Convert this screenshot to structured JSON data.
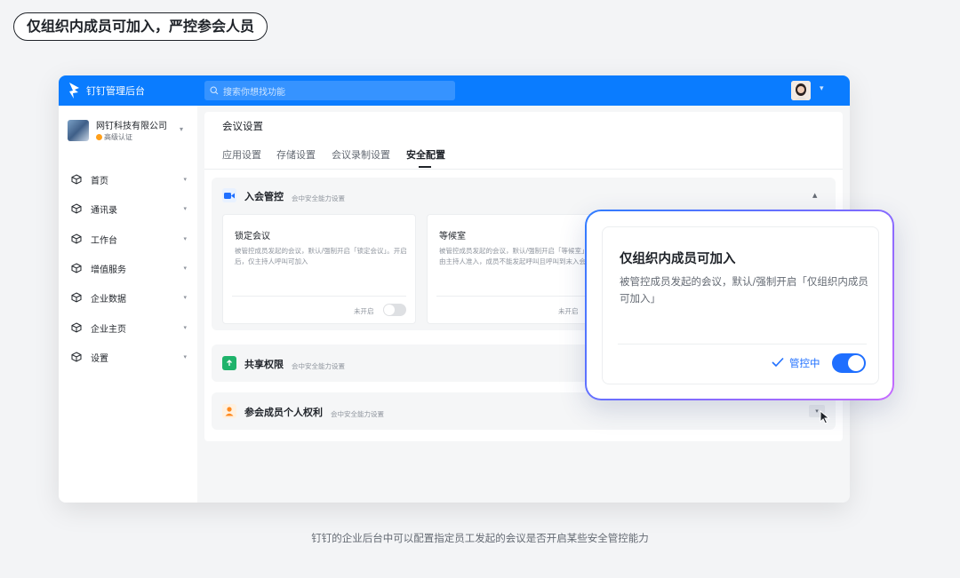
{
  "headline": "仅组织内成员可加入，严控参会人员",
  "app": {
    "name": "钉钉管理后台"
  },
  "search": {
    "placeholder": "搜索你想找功能"
  },
  "org": {
    "name": "网钉科技有限公司",
    "badge": "高级认证"
  },
  "sidebar": {
    "items": [
      {
        "label": "首页",
        "icon": "cube-icon"
      },
      {
        "label": "通讯录",
        "icon": "cube-icon"
      },
      {
        "label": "工作台",
        "icon": "cube-icon"
      },
      {
        "label": "增值服务",
        "icon": "cube-icon"
      },
      {
        "label": "企业数据",
        "icon": "cube-icon"
      },
      {
        "label": "企业主页",
        "icon": "cube-icon"
      },
      {
        "label": "设置",
        "icon": "cube-icon"
      }
    ]
  },
  "page": {
    "title": "会议设置",
    "tabs": [
      "应用设置",
      "存储设置",
      "会议录制设置",
      "安全配置"
    ],
    "active_tab": "安全配置"
  },
  "sections": [
    {
      "title": "入会管控",
      "subtitle": "会中安全能力设置",
      "icon": "video-camera-icon",
      "expanded": true,
      "cards": [
        {
          "title": "锁定会议",
          "desc": "被管控成员发起的会议，默认/强制开启「锁定会议」。开启后，仅主持人呼叫可加入",
          "state": "未开启",
          "on": false
        },
        {
          "title": "等候室",
          "desc": "被管控成员发起的会议，默认/强制开启「等候室」。成员需由主持人准入，成员不能发起呼叫且呼叫到末入会列表",
          "state": "未开启",
          "on": false
        }
      ]
    },
    {
      "title": "共享权限",
      "subtitle": "会中安全能力设置",
      "icon": "share-screen-icon",
      "expanded": false
    },
    {
      "title": "参会成员个人权利",
      "subtitle": "会中安全能力设置",
      "icon": "person-icon",
      "expanded": false
    }
  ],
  "popup": {
    "title": "仅组织内成员可加入",
    "desc": "被管控成员发起的会议，默认/强制开启「仅组织内成员可加入」",
    "status": "管控中",
    "on": true
  },
  "footer": "钉钉的企业后台中可以配置指定员工发起的会议是否开启某些安全管控能力",
  "colors": {
    "primary": "#0a7cff",
    "accent": "#1f6fff",
    "gradient_from": "#2f7cff",
    "gradient_to": "#c66bff"
  }
}
